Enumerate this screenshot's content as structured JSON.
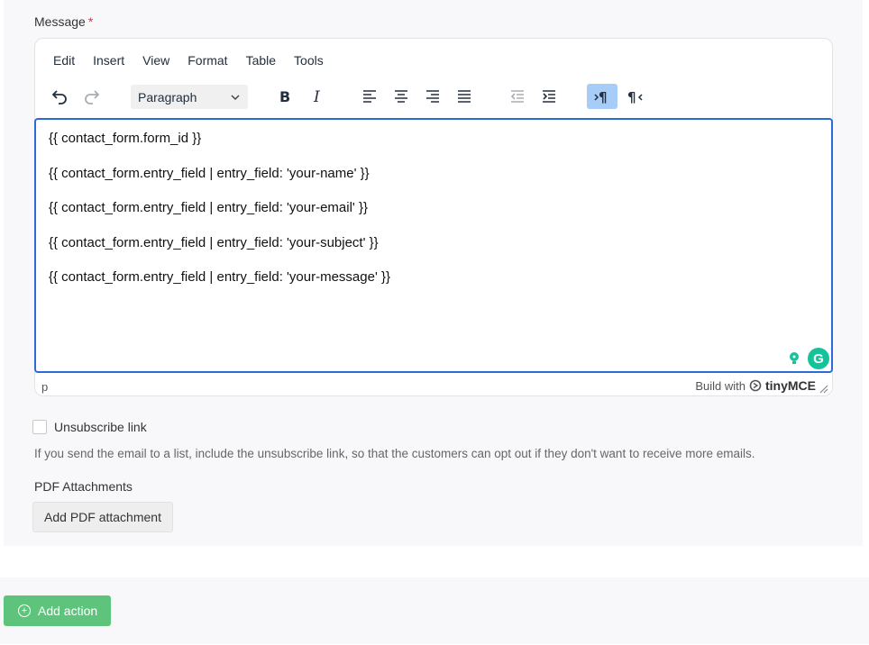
{
  "message_field": {
    "label": "Message",
    "required_mark": "*"
  },
  "editor": {
    "menu": [
      "Edit",
      "Insert",
      "View",
      "Format",
      "Table",
      "Tools"
    ],
    "block_format": "Paragraph",
    "content_lines": [
      "{{ contact_form.form_id }}",
      "{{ contact_form.entry_field | entry_field: 'your-name' }}",
      "{{ contact_form.entry_field | entry_field: 'your-email' }}",
      "{{ contact_form.entry_field | entry_field: 'your-subject' }}",
      "{{ contact_form.entry_field | entry_field: 'your-message' }}"
    ],
    "status_path": "p",
    "branding_prefix": "Build with",
    "branding_name": "tinyMCE",
    "accent_color": "#2d6ad6",
    "active_button_color": "#a6ccf7",
    "grammarly_letter": "G"
  },
  "unsubscribe": {
    "label": "Unsubscribe link",
    "checked": false,
    "help": "If you send the email to a list, include the unsubscribe link, so that the customers can opt out if they don't want to receive more emails."
  },
  "pdf": {
    "label": "PDF Attachments",
    "button": "Add PDF attachment"
  },
  "add_action": {
    "label": "Add action",
    "color": "#5fc47b"
  }
}
